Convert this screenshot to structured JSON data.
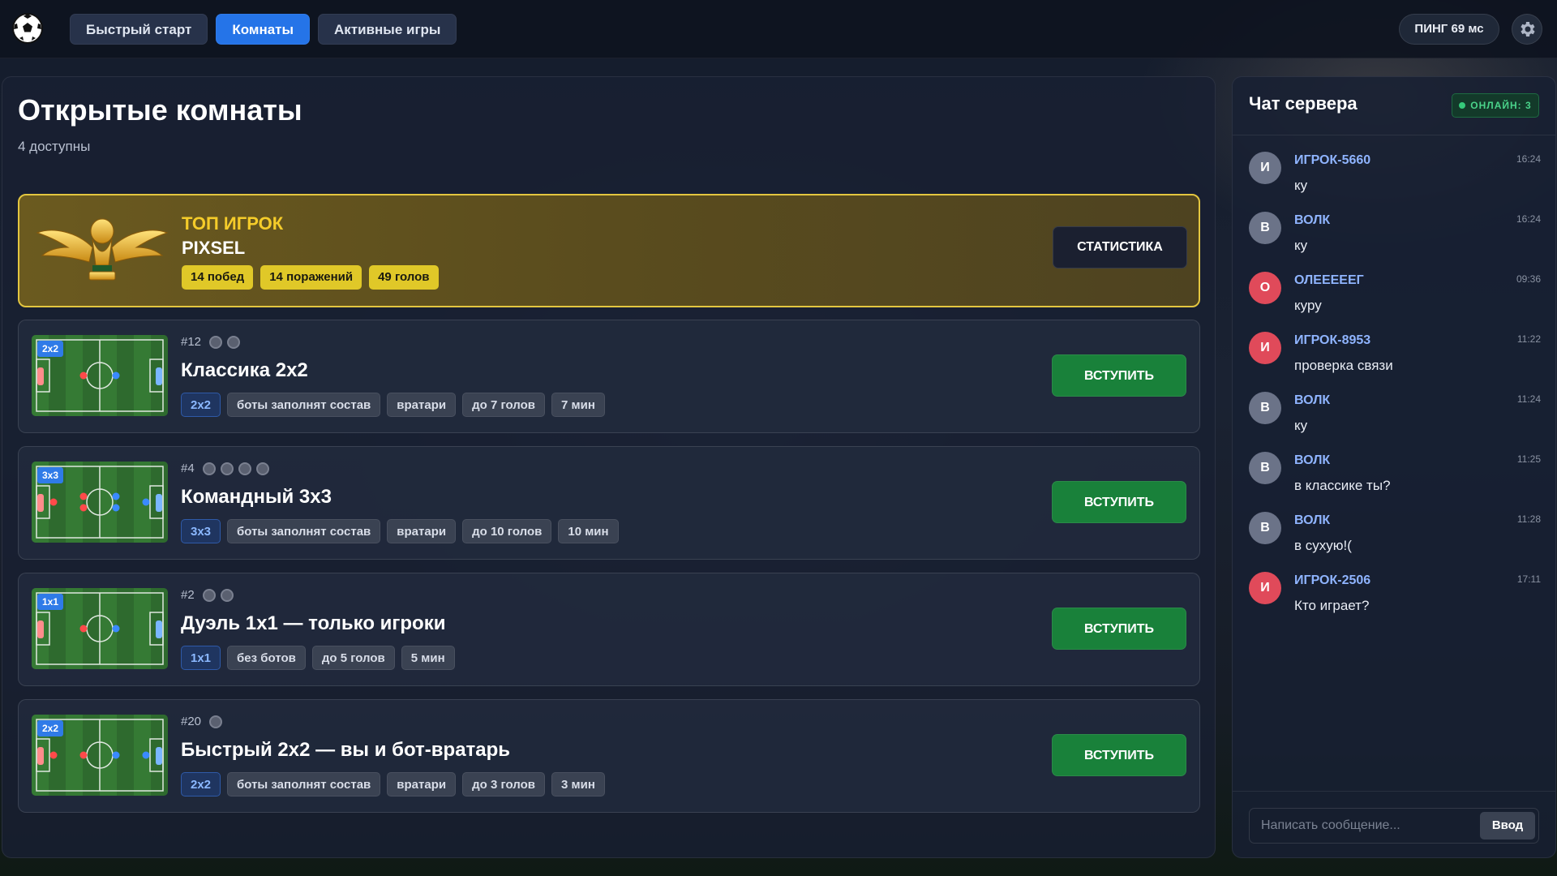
{
  "nav": {
    "items": [
      {
        "label": "Быстрый старт",
        "active": false
      },
      {
        "label": "Комнаты",
        "active": true
      },
      {
        "label": "Активные игры",
        "active": false
      }
    ]
  },
  "ping": "ПИНГ 69 мс",
  "main": {
    "title": "Открытые комнаты",
    "subtitle": "4 доступны"
  },
  "top_player": {
    "label": "ТОП ИГРОК",
    "name": "PIXSEL",
    "badges": [
      "14 побед",
      "14 поражений",
      "49 голов"
    ],
    "button": "СТАТИСТИКА"
  },
  "rooms": [
    {
      "number": "#12",
      "slots": 2,
      "mode": "2x2",
      "title": "Классика 2x2",
      "tags": [
        "2x2",
        "боты заполнят состав",
        "вратари",
        "до 7 голов",
        "7 мин"
      ],
      "button": "ВСТУПИТЬ"
    },
    {
      "number": "#4",
      "slots": 4,
      "mode": "3x3",
      "title": "Командный 3x3",
      "tags": [
        "3x3",
        "боты заполнят состав",
        "вратари",
        "до 10 голов",
        "10 мин"
      ],
      "button": "ВСТУПИТЬ"
    },
    {
      "number": "#2",
      "slots": 2,
      "mode": "1x1",
      "title": "Дуэль 1x1 — только игроки",
      "tags": [
        "1x1",
        "без ботов",
        "до 5 голов",
        "5 мин"
      ],
      "button": "ВСТУПИТЬ"
    },
    {
      "number": "#20",
      "slots": 1,
      "mode": "2x2",
      "title": "Быстрый 2x2 — вы и бот-вратарь",
      "tags": [
        "2x2",
        "боты заполнят состав",
        "вратари",
        "до 3 голов",
        "3 мин"
      ],
      "button": "ВСТУПИТЬ"
    }
  ],
  "chat": {
    "title": "Чат сервера",
    "online": "ОНЛАЙН: 3",
    "messages": [
      {
        "initial": "И",
        "name": "ИГРОК-5660",
        "time": "16:24",
        "text": "ку",
        "color": "#6b7388"
      },
      {
        "initial": "В",
        "name": "ВОЛК",
        "time": "16:24",
        "text": "ку",
        "color": "#6b7388"
      },
      {
        "initial": "О",
        "name": "ОЛЕЕЕЕЕГ",
        "time": "09:36",
        "text": "куру",
        "color": "#e04a5a"
      },
      {
        "initial": "И",
        "name": "ИГРОК-8953",
        "time": "11:22",
        "text": "проверка связи",
        "color": "#e04a5a"
      },
      {
        "initial": "В",
        "name": "ВОЛК",
        "time": "11:24",
        "text": "ку",
        "color": "#6b7388"
      },
      {
        "initial": "В",
        "name": "ВОЛК",
        "time": "11:25",
        "text": "в классике ты?",
        "color": "#6b7388"
      },
      {
        "initial": "В",
        "name": "ВОЛК",
        "time": "11:28",
        "text": "в сухую!(",
        "color": "#6b7388"
      },
      {
        "initial": "И",
        "name": "ИГРОК-2506",
        "time": "17:11",
        "text": "Кто играет?",
        "color": "#e04a5a"
      }
    ],
    "input_placeholder": "Написать сообщение...",
    "send_label": "Ввод"
  },
  "colors": {
    "accent": "#2574e8",
    "join": "#19813a",
    "gold": "#e3c640",
    "online": "#35c97a"
  }
}
